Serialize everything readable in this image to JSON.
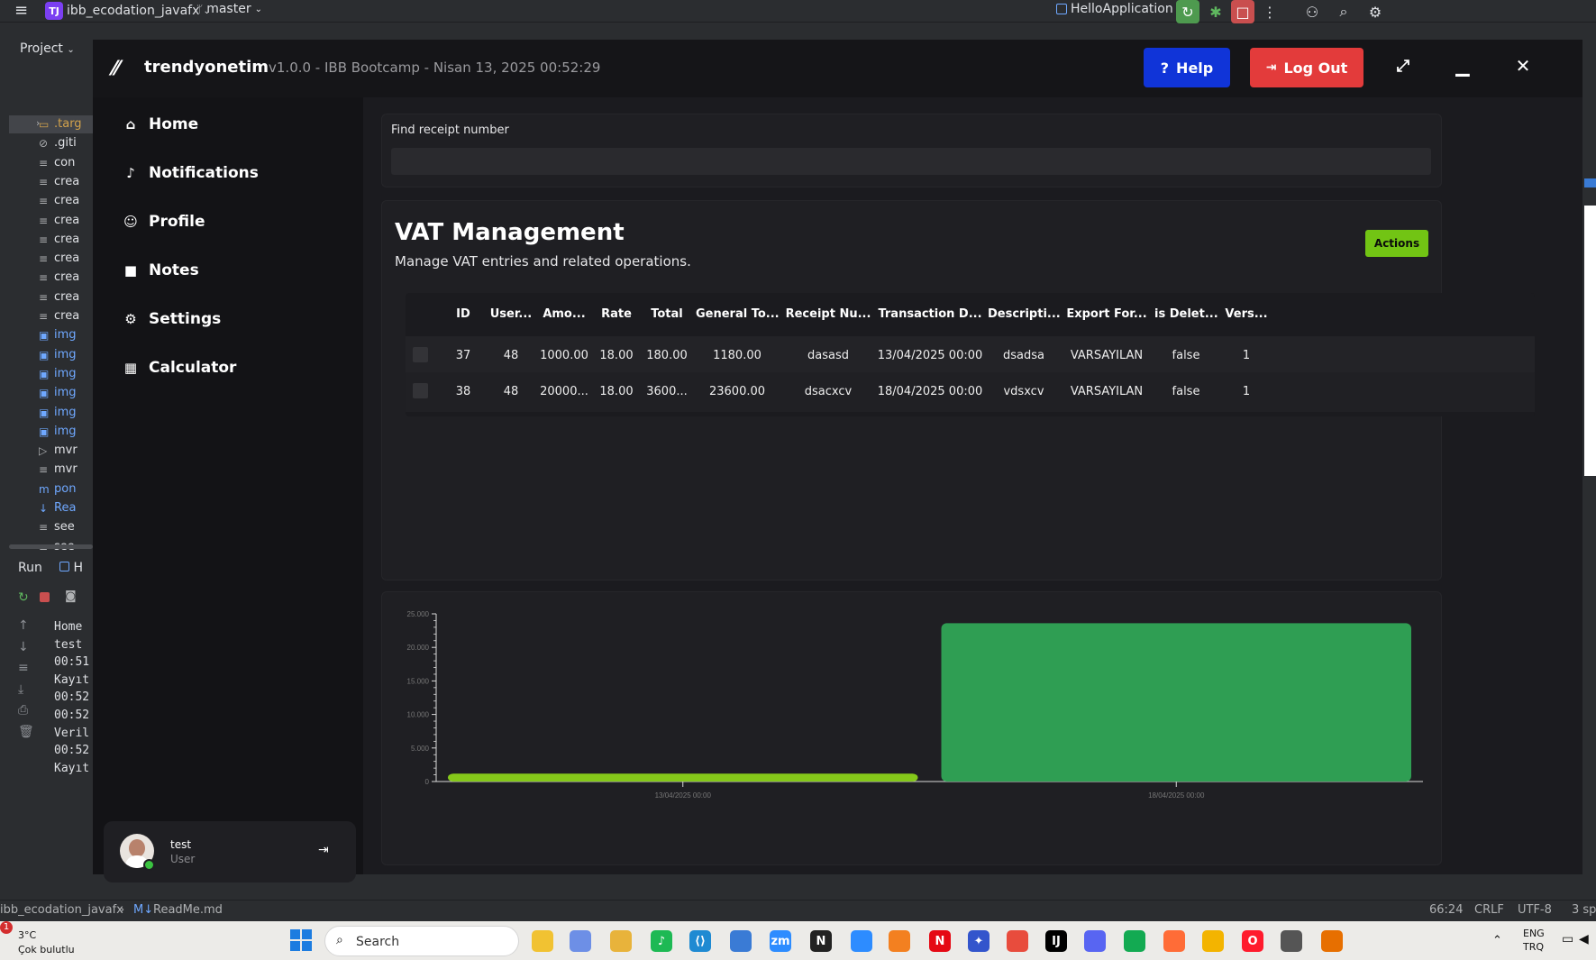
{
  "ide": {
    "project": "ibb_ecodation_javafx",
    "branch": "master",
    "run_config": "HelloApplication",
    "project_label": "Project",
    "tree": [
      {
        "name": ".targ",
        "icon": "folder-icon",
        "kind": "folder"
      },
      {
        "name": ".giti",
        "icon": "ignore-file-icon",
        "kind": "file"
      },
      {
        "name": "con",
        "icon": "text-file-icon",
        "kind": "file"
      },
      {
        "name": "crea",
        "icon": "text-file-icon",
        "kind": "file"
      },
      {
        "name": "crea",
        "icon": "text-file-icon",
        "kind": "file"
      },
      {
        "name": "crea",
        "icon": "text-file-icon",
        "kind": "file"
      },
      {
        "name": "crea",
        "icon": "text-file-icon",
        "kind": "file"
      },
      {
        "name": "crea",
        "icon": "text-file-icon",
        "kind": "file"
      },
      {
        "name": "crea",
        "icon": "text-file-icon",
        "kind": "file"
      },
      {
        "name": "crea",
        "icon": "text-file-icon",
        "kind": "file"
      },
      {
        "name": "crea",
        "icon": "text-file-icon",
        "kind": "file"
      },
      {
        "name": "img",
        "icon": "image-file-icon",
        "kind": "image"
      },
      {
        "name": "img",
        "icon": "image-file-icon",
        "kind": "image"
      },
      {
        "name": "img",
        "icon": "image-file-icon",
        "kind": "image"
      },
      {
        "name": "img",
        "icon": "image-file-icon",
        "kind": "image"
      },
      {
        "name": "img",
        "icon": "image-file-icon",
        "kind": "image"
      },
      {
        "name": "img",
        "icon": "image-file-icon",
        "kind": "image"
      },
      {
        "name": "mvr",
        "icon": "terminal-file-icon",
        "kind": "file"
      },
      {
        "name": "mvr",
        "icon": "text-file-icon",
        "kind": "file"
      },
      {
        "name": "pon",
        "icon": "maven-icon",
        "kind": "maven"
      },
      {
        "name": "Rea",
        "icon": "markdown-icon",
        "kind": "markdown"
      },
      {
        "name": "see",
        "icon": "text-file-icon",
        "kind": "file"
      },
      {
        "name": "see",
        "icon": "text-file-icon",
        "kind": "file"
      }
    ],
    "run_tab": "Run",
    "run_tab2": "H",
    "console_lines": [
      "Home",
      "test",
      "00:51",
      "Kayıt",
      "00:52",
      "00:52",
      "Veril",
      "00:52",
      "Kayıt"
    ],
    "breadcrumb_project": "ibb_ecodation_javafx",
    "breadcrumb_file": "ReadMe.md",
    "status_position": "66:24",
    "status_eol": "CRLF",
    "status_encoding": "UTF-8",
    "status_indent": "3 sp"
  },
  "app": {
    "brand": "trendyonetim",
    "version": "v1.0.0 - IBB Bootcamp - Nisan 13, 2025  00:52:29",
    "help_label": "Help",
    "logout_label": "Log Out",
    "nav": [
      {
        "label": "Home",
        "icon": "home-icon",
        "glyph": "⌂"
      },
      {
        "label": "Notifications",
        "icon": "bell-icon",
        "glyph": "♪"
      },
      {
        "label": "Profile",
        "icon": "user-icon",
        "glyph": "☺"
      },
      {
        "label": "Notes",
        "icon": "note-icon",
        "glyph": "■"
      },
      {
        "label": "Settings",
        "icon": "gear-icon",
        "glyph": "⚙"
      },
      {
        "label": "Calculator",
        "icon": "calculator-icon",
        "glyph": "▦"
      }
    ],
    "user": {
      "name": "test",
      "role": "User"
    },
    "find_label": "Find receipt number",
    "find_placeholder": "",
    "vat_title": "VAT Management",
    "vat_subtitle": "Manage VAT entries and related operations.",
    "actions_label": "Actions",
    "table": {
      "columns": [
        "ID",
        "User...",
        "Amo...",
        "Rate",
        "Total",
        "General To...",
        "Receipt Nu...",
        "Transaction D...",
        "Descripti...",
        "Export For...",
        "is Delet...",
        "Vers..."
      ],
      "rows": [
        [
          "37",
          "48",
          "1000.00",
          "18.00",
          "180.00",
          "1180.00",
          "dasasd",
          "13/04/2025 00:00",
          "dsadsa",
          "VARSAYILAN",
          "false",
          "1"
        ],
        [
          "38",
          "48",
          "20000...",
          "18.00",
          "3600...",
          "23600.00",
          "dsacxcv",
          "18/04/2025 00:00",
          "vdsxcv",
          "VARSAYILAN",
          "false",
          "1"
        ]
      ]
    }
  },
  "chart_data": {
    "type": "bar",
    "categories": [
      "13/04/2025 00:00",
      "18/04/2025 00:00"
    ],
    "values": [
      1180,
      23600
    ],
    "colors": [
      "#85c81a",
      "#2f9e53"
    ],
    "ylim": [
      0,
      25000
    ],
    "yticks": [
      "0",
      "5.000",
      "10.000",
      "15.000",
      "20.000",
      "25.000"
    ],
    "grid": false,
    "title": "",
    "xlabel": "",
    "ylabel": ""
  },
  "taskbar": {
    "weather_temp": "3°C",
    "weather_desc": "Çok bulutlu",
    "weather_badge": "1",
    "search_label": "Search",
    "lang_top": "ENG",
    "lang_bottom": "TRQ"
  },
  "colors": {
    "help": "#1034d8",
    "logout": "#e33b3b",
    "actions": "#72c414",
    "bar1": "#85c81a",
    "bar2": "#2f9e53"
  }
}
